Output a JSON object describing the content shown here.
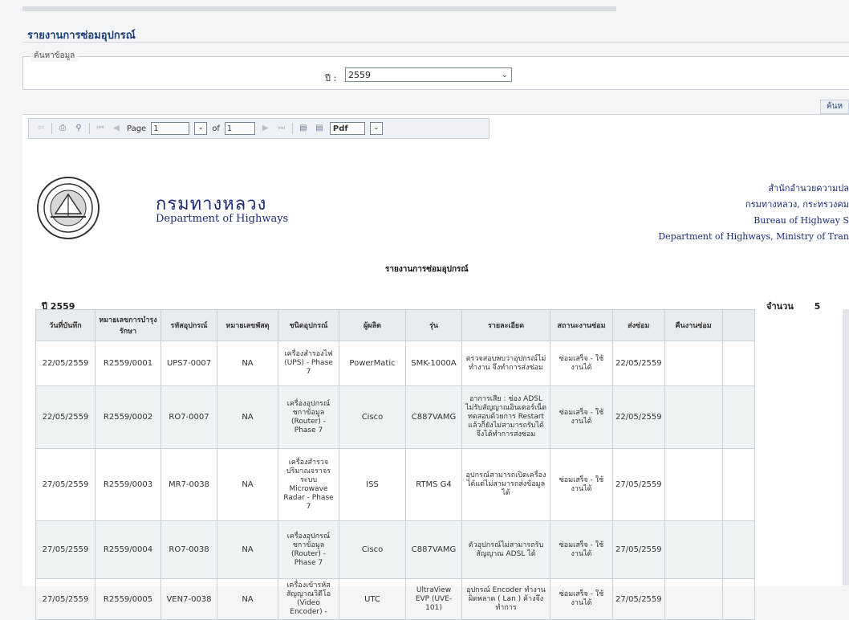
{
  "page_title": "รายงานการซ่อมอุปกรณ์",
  "search": {
    "legend": "ค้นหาข้อมูล",
    "year_label": "ปี :",
    "year_value": "2559",
    "button_label": "ค้นห"
  },
  "toolbar": {
    "page_label": "Page",
    "page_value": "1",
    "of_label": "of",
    "total_pages": "1",
    "export_format": "Pdf"
  },
  "header": {
    "org_th": "กรมทางหลวง",
    "org_en": "Department of Highways",
    "right_line1": "สำนักอำนวยความปล",
    "right_line2": "กรมทางหลวง, กระทรวงคม",
    "right_line3": "Bureau of Highway S",
    "right_line4": "Department of Highways, Ministry of Tran"
  },
  "report": {
    "title": "รายงานการซ่อมอุปกรณ์",
    "year_caption": "ปี  2559",
    "count_label": "จำนวน",
    "count_value": "5"
  },
  "table": {
    "columns": [
      "วันที่บันทึก",
      "หมายเลขการบำรุงรักษา",
      "รหัสอุปกรณ์",
      "หมายเลขพัสดุ",
      "ชนิดอุปกรณ์",
      "ผู้ผลิต",
      "รุ่น",
      "รายละเอียด",
      "สถานะงานซ่อม",
      "ส่งซ่อม",
      "คืนงานซ่อม"
    ],
    "rows": [
      [
        "22/05/2559",
        "R2559/0001",
        "UPS7-0007",
        "NA",
        "เครื่องสำรองไฟ (UPS) - Phase 7",
        "PowerMatic",
        "SMK-1000A",
        "ตรวจสอบพบว่าอุปกรณ์ไม่ทำงาน จึงทำการส่งซ่อม",
        "ซ่อมเสร็จ - ใช้งานได้",
        "22/05/2559",
        ""
      ],
      [
        "22/05/2559",
        "R2559/0002",
        "RO7-0007",
        "NA",
        "เครื่องอุปกรณ์ชกาข้อมูล (Router) - Phase 7",
        "Cisco",
        "C887VAMG",
        "อาการเสีย : ช่อง ADSL ไม่รับสัญญาณอินเตอร์เน็ต ทดสอบด้วยการ Restart แล้วก็ยังไม่สามารถรับได้จึงได้ทำการส่งซ่อม",
        "ซ่อมเสร็จ - ใช้งานได้",
        "22/05/2559",
        ""
      ],
      [
        "27/05/2559",
        "R2559/0003",
        "MR7-0038",
        "NA",
        "เครื่องสำรวจปริมาณจราจรระบบ Microwave Radar - Phase 7",
        "ISS",
        "RTMS G4",
        "อุปกรณ์สามารถเปิดเครื่องได้แต่ไม่สามารถส่งข้อมูลได้",
        "ซ่อมเสร็จ - ใช้งานได้",
        "27/05/2559",
        ""
      ],
      [
        "27/05/2559",
        "R2559/0004",
        "RO7-0038",
        "NA",
        "เครื่องอุปกรณ์ชกาข้อมูล (Router) - Phase 7",
        "Cisco",
        "C887VAMG",
        "ตัวอุปกรณ์ไม่สามารถรับสัญญาณ ADSL ได้",
        "ซ่อมเสร็จ - ใช้งานได้",
        "27/05/2559",
        ""
      ],
      [
        "27/05/2559",
        "R2559/0005",
        "VEN7-0038",
        "NA",
        "เครื่องเข้ารหัสสัญญาณวิดีโอ (Video Encoder) -",
        "UTC",
        "UltraView EVP (UVE-101)",
        "อุปกรณ์ Encoder ทำงานผิดพลาด ( Lan ) ค้างจึงทำการ",
        "ซ่อมเสร็จ - ใช้งานได้",
        "27/05/2559",
        ""
      ]
    ]
  },
  "icons": {
    "tb_first": "first-page-icon",
    "tb_print": "print-icon",
    "tb_export": "export-icon"
  }
}
